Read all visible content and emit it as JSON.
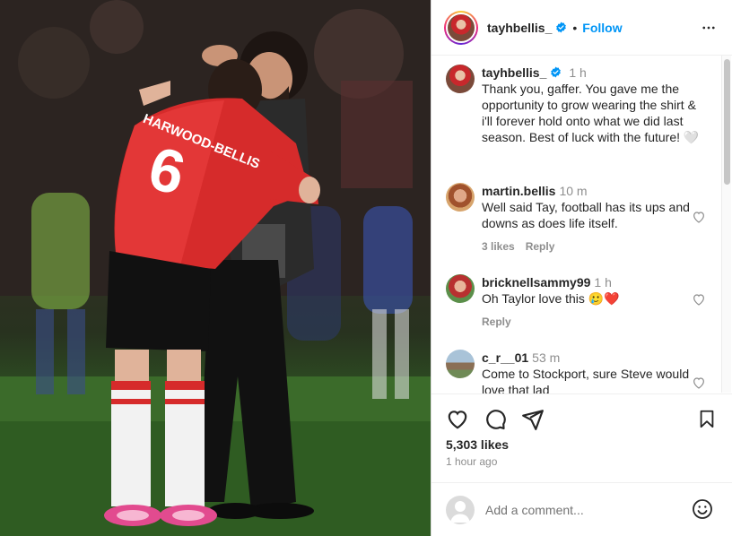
{
  "post": {
    "author": "tayhbellis_",
    "follow_label": "Follow",
    "separator": "•",
    "photo_jersey_name": "HARWOOD-BELLIS",
    "photo_jersey_number": "6"
  },
  "comments": [
    {
      "user": "tayhbellis_",
      "time": "1 h",
      "text": "Thank you, gaffer. You gave me the opportunity to grow wearing the shirt & i'll forever hold onto what we did last season. Best of luck with the future! 🤍",
      "verified": true
    },
    {
      "user": "martin.bellis",
      "time": "10 m",
      "text": "Well said Tay, football has its ups and downs as does life itself.",
      "likes_label": "3 likes",
      "reply_label": "Reply"
    },
    {
      "user": "bricknellsammy99",
      "time": "1 h",
      "text": "Oh Taylor love this 🥲❤️",
      "reply_label": "Reply"
    },
    {
      "user": "c_r__01",
      "time": "53 m",
      "text": "Come to Stockport, sure Steve would love that lad"
    }
  ],
  "footer": {
    "likes": "5,303 likes",
    "posted": "1 hour ago",
    "add_comment_placeholder": "Add a comment..."
  },
  "icons": {
    "like": "heart-icon",
    "comment": "comment-icon",
    "share": "share-icon",
    "save": "bookmark-icon",
    "more": "more-options-icon",
    "emoji": "emoji-icon",
    "verified": "verified-badge-icon"
  },
  "colors": {
    "follow": "#0095f6",
    "verified": "#0095f6",
    "secondary_text": "#8e8e8e"
  }
}
